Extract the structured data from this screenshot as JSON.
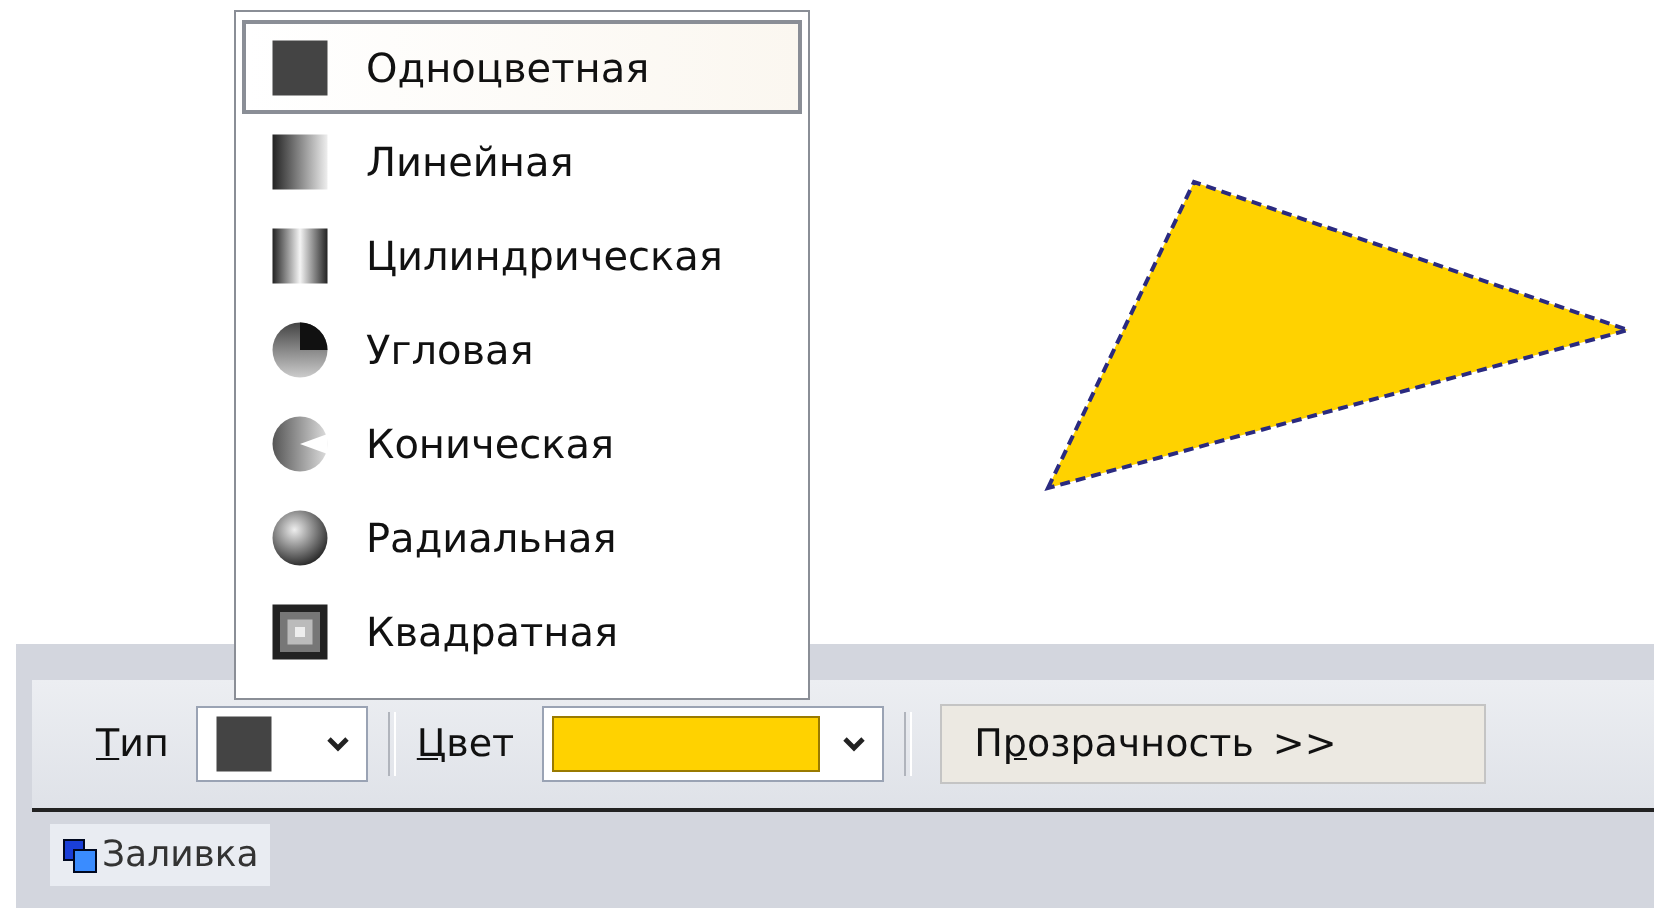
{
  "fill_type_menu": [
    {
      "label": "Одноцветная",
      "kind": "solid",
      "selected": true
    },
    {
      "label": "Линейная",
      "kind": "linear",
      "selected": false
    },
    {
      "label": "Цилиндрическая",
      "kind": "cylindrical",
      "selected": false
    },
    {
      "label": "Угловая",
      "kind": "angular",
      "selected": false
    },
    {
      "label": "Коническая",
      "kind": "conical",
      "selected": false
    },
    {
      "label": "Радиальная",
      "kind": "radial",
      "selected": false
    },
    {
      "label": "Квадратная",
      "kind": "square",
      "selected": false
    }
  ],
  "toolbar": {
    "type_label": {
      "key": "Т",
      "rest": "ип"
    },
    "type_value": {
      "kind": "solid"
    },
    "color_label": {
      "key": "Ц",
      "rest": "вет"
    },
    "color_value": {
      "color": "#ffd200"
    },
    "transparency_button": {
      "pre": "П",
      "key": "р",
      "rest": "озрачность",
      "arrow": ">>"
    }
  },
  "panel_tab": {
    "label": "Заливка"
  }
}
